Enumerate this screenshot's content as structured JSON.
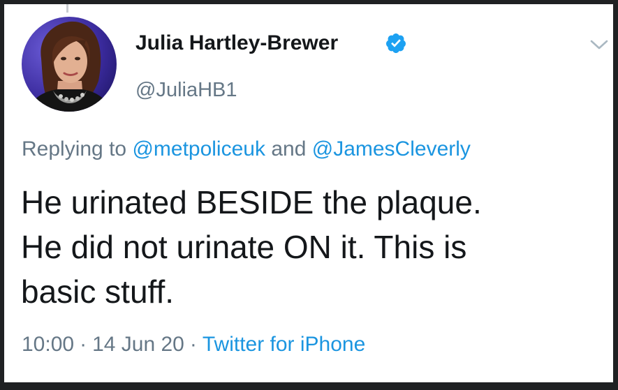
{
  "author": {
    "display_name": "Julia Hartley-Brewer",
    "handle": "@JuliaHB1",
    "verified": true
  },
  "reply": {
    "prefix": "Replying to",
    "mention1": "@metpoliceuk",
    "conjunction": "and",
    "mention2": "@JamesCleverly"
  },
  "tweet": {
    "lines": [
      "He urinated BESIDE the plaque.",
      "He did not urinate ON it. This is",
      "basic stuff."
    ]
  },
  "meta": {
    "time": "10:00",
    "separator": "·",
    "date": "14 Jun 20",
    "source": "Twitter for iPhone"
  },
  "icons": {
    "verified": "verified-badge-icon",
    "caret": "chevron-down-icon"
  },
  "colors": {
    "link": "#1b95e0",
    "muted": "#657786",
    "text": "#14171a",
    "verified": "#1da1f2"
  }
}
